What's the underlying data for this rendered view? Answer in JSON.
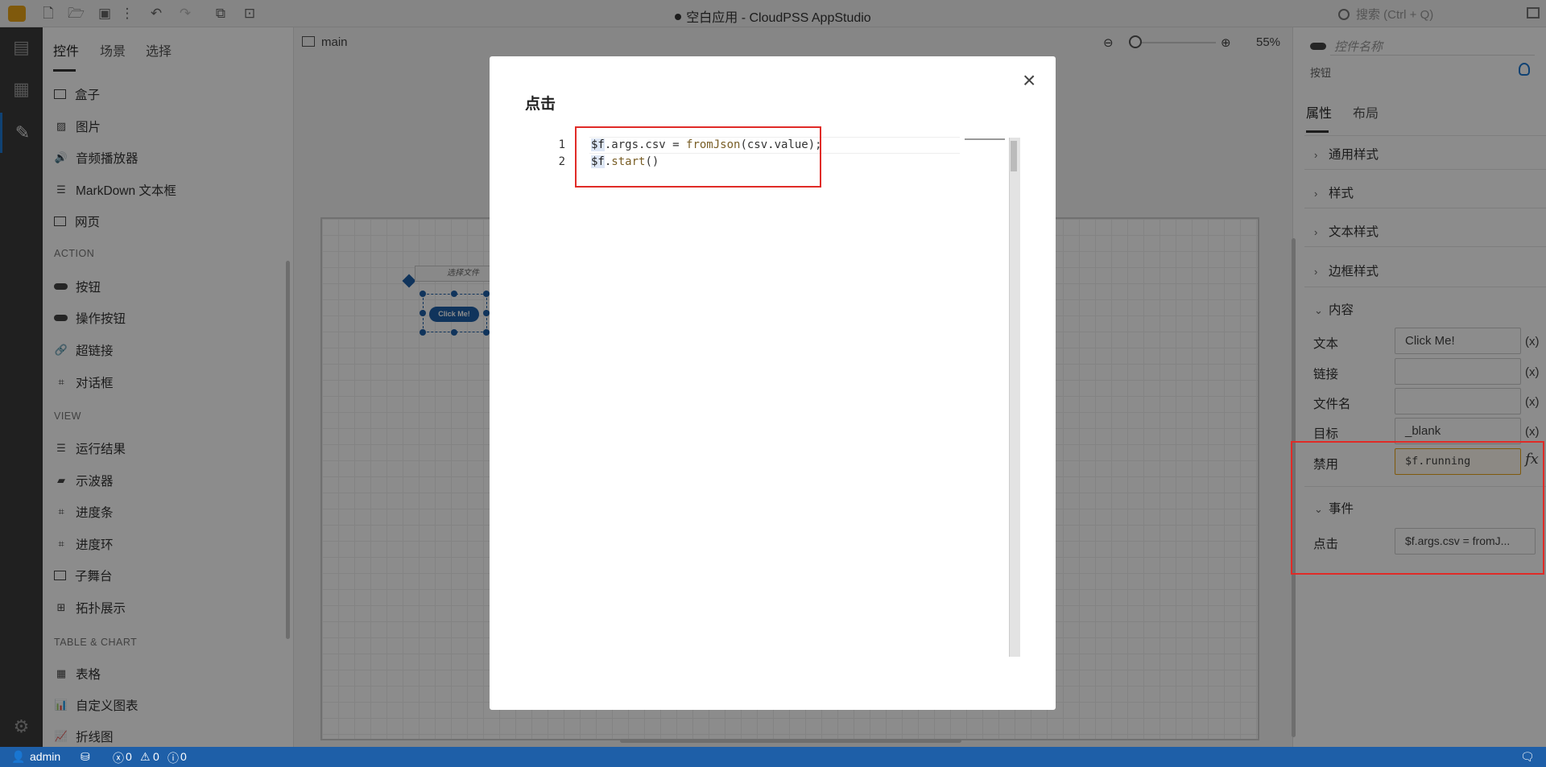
{
  "app": {
    "title": "空白应用 - CloudPSS AppStudio",
    "search_placeholder": "搜索 (Ctrl + Q)"
  },
  "left_panel": {
    "tabs": [
      "控件",
      "场景",
      "选择"
    ],
    "items_top": [
      {
        "label": "盒子",
        "icon": "box-icon"
      },
      {
        "label": "图片",
        "icon": "image-icon"
      },
      {
        "label": "音频播放器",
        "icon": "speaker-icon"
      },
      {
        "label": "MarkDown 文本框",
        "icon": "list-icon"
      },
      {
        "label": "网页",
        "icon": "window-icon"
      }
    ],
    "section_action": "ACTION",
    "items_action": [
      {
        "label": "按钮",
        "icon": "pill-icon"
      },
      {
        "label": "操作按钮",
        "icon": "pill-icon"
      },
      {
        "label": "超链接",
        "icon": "link-icon"
      },
      {
        "label": "对话框",
        "icon": "dialog-icon"
      }
    ],
    "section_view": "VIEW",
    "items_view": [
      {
        "label": "运行结果",
        "icon": "list-icon"
      },
      {
        "label": "示波器",
        "icon": "monitor-icon"
      },
      {
        "label": "进度条",
        "icon": "progress-icon"
      },
      {
        "label": "进度环",
        "icon": "progress-ring-icon"
      },
      {
        "label": "子舞台",
        "icon": "window-icon"
      },
      {
        "label": "拓扑展示",
        "icon": "topology-icon"
      }
    ],
    "section_table": "TABLE & CHART",
    "items_table": [
      {
        "label": "表格",
        "icon": "table-icon"
      },
      {
        "label": "自定义图表",
        "icon": "chart-icon"
      },
      {
        "label": "折线图",
        "icon": "line-chart-icon"
      }
    ]
  },
  "canvas": {
    "tab_label": "main",
    "zoom": "55%",
    "select_file_label": "选择文件",
    "button_label": "Click Me!"
  },
  "right_panel": {
    "name_placeholder": "控件名称",
    "type": "按钮",
    "tabs": [
      "属性",
      "布局"
    ],
    "sections": [
      "通用样式",
      "样式",
      "文本样式",
      "边框样式",
      "内容"
    ],
    "fields": [
      {
        "label": "文本",
        "value": "Click Me!",
        "suffix": "(x)"
      },
      {
        "label": "链接",
        "value": "",
        "suffix": "(x)"
      },
      {
        "label": "文件名",
        "value": "",
        "suffix": "(x)"
      },
      {
        "label": "目标",
        "value": "_blank",
        "suffix": "(x)"
      },
      {
        "label": "禁用",
        "value": "$f.running",
        "suffix": "fx"
      }
    ],
    "events_section": "事件",
    "event": {
      "label": "点击",
      "value": "$f.args.csv = fromJ..."
    }
  },
  "dialog": {
    "title": "点击",
    "close": "×",
    "line_numbers": [
      "1",
      "2"
    ],
    "code_lines": [
      "$f.args.csv = fromJson(csv.value);",
      "$f.start()"
    ]
  },
  "status": {
    "user": "admin",
    "errors": "0",
    "warnings": "0",
    "infos": "0"
  }
}
